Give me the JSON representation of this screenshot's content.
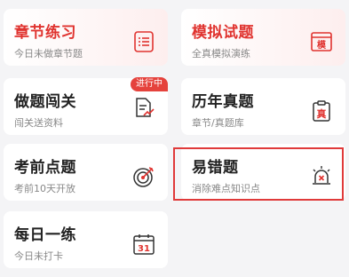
{
  "cards": [
    {
      "title": "章节练习",
      "subtitle": "今日未做章节题",
      "icon": "list-doc-icon"
    },
    {
      "title": "模拟试题",
      "subtitle": "全真模拟演练",
      "icon": "mock-exam-icon",
      "icon_glyph": "模"
    },
    {
      "title": "做题闯关",
      "subtitle": "闯关送资料",
      "icon": "doc-trend-icon",
      "badge": "进行中"
    },
    {
      "title": "历年真题",
      "subtitle": "章节/真题库",
      "icon": "clipboard-icon",
      "icon_glyph": "真"
    },
    {
      "title": "考前点题",
      "subtitle": "考前10天开放",
      "icon": "target-icon"
    },
    {
      "title": "易错题",
      "subtitle": "消除难点知识点",
      "icon": "alarm-icon"
    },
    {
      "title": "每日一练",
      "subtitle": "今日未打卡",
      "icon": "calendar-icon",
      "icon_glyph": "31"
    }
  ],
  "colors": {
    "accent": "#e0332f",
    "badge": "#e5423c",
    "highlight": "#e03a3a"
  }
}
